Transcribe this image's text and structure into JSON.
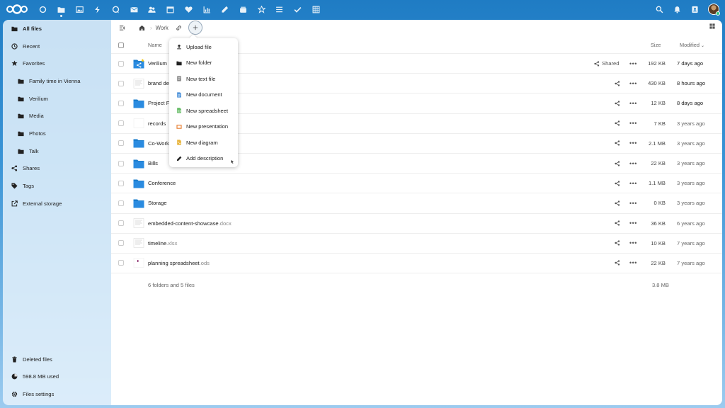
{
  "topbar": {
    "apps": [
      "dashboard",
      "files",
      "photos",
      "activity",
      "talk",
      "mail",
      "contacts",
      "calendar",
      "favorites",
      "analytics",
      "notes",
      "deck",
      "tasks-list",
      "checklist",
      "tables"
    ],
    "active_app": "files"
  },
  "sidebar": {
    "items": [
      {
        "label": "All files",
        "icon": "folder-icon"
      },
      {
        "label": "Recent",
        "icon": "clock-icon"
      },
      {
        "label": "Favorites",
        "icon": "star-icon"
      },
      {
        "label": "Family time in Vienna",
        "icon": "folder-icon"
      },
      {
        "label": "Verilium",
        "icon": "folder-icon"
      },
      {
        "label": "Media",
        "icon": "folder-icon"
      },
      {
        "label": "Photos",
        "icon": "folder-icon"
      },
      {
        "label": "Talk",
        "icon": "folder-icon"
      },
      {
        "label": "Shares",
        "icon": "share-icon"
      },
      {
        "label": "Tags",
        "icon": "tag-icon"
      },
      {
        "label": "External storage",
        "icon": "external-icon"
      }
    ],
    "bottom": [
      {
        "label": "Deleted files",
        "icon": "trash-icon"
      },
      {
        "label": "598.8 MB used",
        "icon": "pie-icon"
      },
      {
        "label": "Files settings",
        "icon": "gear-icon"
      }
    ]
  },
  "breadcrumb": {
    "current": "Work"
  },
  "table": {
    "header": {
      "name": "Name",
      "size": "Size",
      "modified": "Modified"
    },
    "rows": [
      {
        "name": "Verilium",
        "ext": "",
        "kind": "shared-folder",
        "shared": "Shared",
        "size": "192 KB",
        "modified": "7 days ago",
        "recent": true
      },
      {
        "name": "brand de",
        "ext": "",
        "kind": "doc",
        "shared": "",
        "size": "430 KB",
        "modified": "8 hours ago",
        "recent": true
      },
      {
        "name": "Project F",
        "ext": "",
        "kind": "folder",
        "shared": "",
        "size": "12 KB",
        "modified": "8 days ago",
        "recent": true
      },
      {
        "name": "records",
        "ext": "",
        "kind": "blank",
        "shared": "",
        "size": "7 KB",
        "modified": "3 years ago",
        "recent": false
      },
      {
        "name": "Co-Work",
        "ext": "",
        "kind": "folder",
        "shared": "",
        "size": "2.1 MB",
        "modified": "3 years ago",
        "recent": false
      },
      {
        "name": "Bills",
        "ext": "",
        "kind": "folder",
        "shared": "",
        "size": "22 KB",
        "modified": "3 years ago",
        "recent": false
      },
      {
        "name": "Conference",
        "ext": "",
        "kind": "folder",
        "shared": "",
        "size": "1.1 MB",
        "modified": "3 years ago",
        "recent": false
      },
      {
        "name": "Storage",
        "ext": "",
        "kind": "folder",
        "shared": "",
        "size": "0 KB",
        "modified": "3 years ago",
        "recent": false
      },
      {
        "name": "embedded-content-showcase",
        "ext": ".docx",
        "kind": "doc",
        "shared": "",
        "size": "36 KB",
        "modified": "6 years ago",
        "recent": false
      },
      {
        "name": "timeline",
        "ext": ".xlsx",
        "kind": "doc",
        "shared": "",
        "size": "10 KB",
        "modified": "7 years ago",
        "recent": false
      },
      {
        "name": "planning spreadsheet",
        "ext": ".ods",
        "kind": "ods",
        "shared": "",
        "size": "22 KB",
        "modified": "7 years ago",
        "recent": false
      }
    ],
    "summary": "6 folders and 5 files",
    "summary_size": "3.8 MB"
  },
  "new_menu": {
    "items": [
      {
        "label": "Upload file",
        "icon": "upload-icon",
        "color": "#222222"
      },
      {
        "label": "New folder",
        "icon": "folder-icon",
        "color": "#222222"
      },
      {
        "label": "New text file",
        "icon": "text-file-icon",
        "color": "#777777"
      },
      {
        "label": "New document",
        "icon": "document-icon",
        "color": "#4a90d9"
      },
      {
        "label": "New spreadsheet",
        "icon": "spreadsheet-icon",
        "color": "#5cb85c"
      },
      {
        "label": "New presentation",
        "icon": "presentation-icon",
        "color": "#e8843b"
      },
      {
        "label": "New diagram",
        "icon": "diagram-icon",
        "color": "#e8b43b"
      },
      {
        "label": "Add description",
        "icon": "pencil-icon",
        "color": "#222222"
      }
    ]
  },
  "colors": {
    "accent": "#0082c9",
    "folder": "#1a7ccc"
  }
}
